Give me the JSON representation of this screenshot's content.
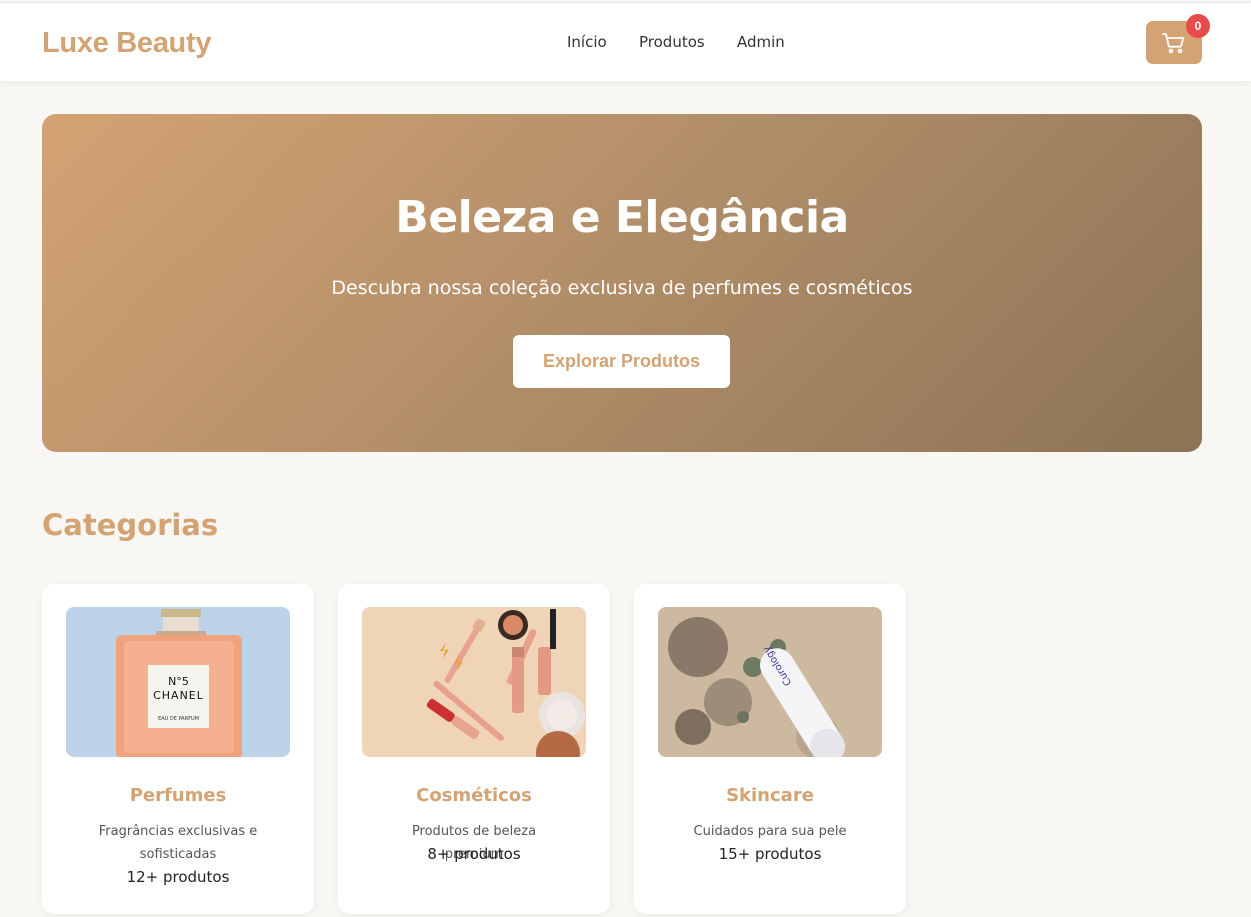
{
  "header": {
    "logo": "Luxe Beauty",
    "nav": [
      {
        "label": "Início"
      },
      {
        "label": "Produtos"
      },
      {
        "label": "Admin"
      }
    ],
    "cart": {
      "icon": "shopping-cart-icon",
      "count": "0"
    }
  },
  "hero": {
    "title": "Beleza e Elegância",
    "subtitle": "Descubra nossa coleção exclusiva de perfumes e cosméticos",
    "cta_label": "Explorar Produtos"
  },
  "categories": {
    "title": "Categorias",
    "items": [
      {
        "name": "Perfumes",
        "description": "Fragrâncias exclusivas e sofisticadas",
        "count": "12+ produtos",
        "bottle_label_top": "N°5",
        "bottle_label_brand": "CHANEL",
        "bottle_label_bottom": "EAU DE PARFUM"
      },
      {
        "name": "Cosméticos",
        "description": "Produtos de beleza premium",
        "count": "8+ produtos"
      },
      {
        "name": "Skincare",
        "description": "Cuidados para sua pele",
        "count": "15+ produtos",
        "tube_label": "Curology"
      }
    ]
  },
  "colors": {
    "accent": "#d4a373",
    "hero_end": "#8b7355",
    "badge": "#e84b4b",
    "background": "#f9f7f3"
  }
}
